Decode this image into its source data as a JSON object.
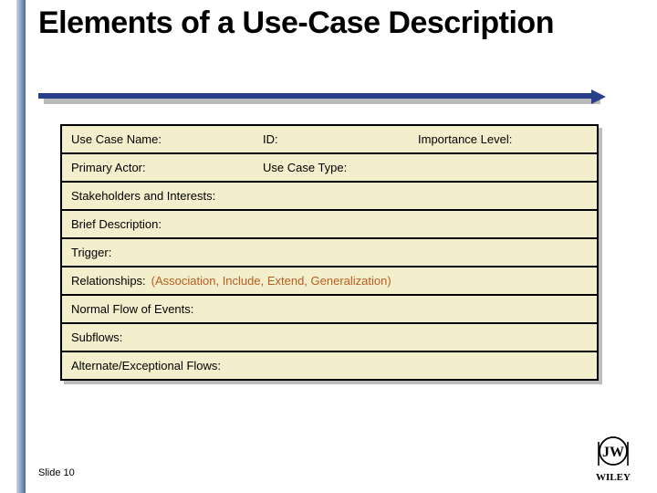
{
  "title": "Elements of a Use-Case Description",
  "rows": {
    "r1": {
      "name": "Use Case Name:",
      "id": "ID:",
      "importance": "Importance Level:"
    },
    "r2": {
      "actor": "Primary Actor:",
      "type": "Use Case Type:"
    },
    "r3": {
      "label": "Stakeholders and Interests:"
    },
    "r4": {
      "label": "Brief Description:"
    },
    "r5": {
      "label": "Trigger:"
    },
    "r6": {
      "label": "Relationships:",
      "note": "(Association, Include, Extend, Generalization)"
    },
    "r7": {
      "label": "Normal Flow of Events:"
    },
    "r8": {
      "label": "Subflows:"
    },
    "r9": {
      "label": "Alternate/Exceptional Flows:"
    }
  },
  "footer": "Slide 10",
  "publisher": "WILEY"
}
